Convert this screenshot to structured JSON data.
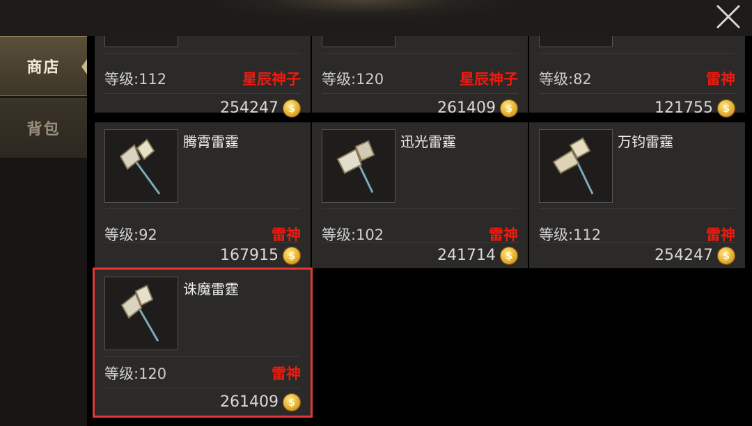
{
  "window": {
    "close_icon": "close-icon"
  },
  "sidebar": {
    "tabs": [
      {
        "label": "商店",
        "active": true
      },
      {
        "label": "背包",
        "active": false
      }
    ]
  },
  "currency_icon": "gold-coin-icon",
  "coin_glyph": "$",
  "items": [
    {
      "name": "",
      "level": "等级:112",
      "tag": "星辰神子",
      "price": "254247"
    },
    {
      "name": "",
      "level": "等级:120",
      "tag": "星辰神子",
      "price": "261409"
    },
    {
      "name": "",
      "level": "等级:82",
      "tag": "雷神",
      "price": "121755"
    },
    {
      "name": "腾霄雷霆",
      "level": "等级:92",
      "tag": "雷神",
      "price": "167915"
    },
    {
      "name": "迅光雷霆",
      "level": "等级:102",
      "tag": "雷神",
      "price": "241714"
    },
    {
      "name": "万钧雷霆",
      "level": "等级:112",
      "tag": "雷神",
      "price": "254247"
    },
    {
      "name": "诛魔雷霆",
      "level": "等级:120",
      "tag": "雷神",
      "price": "261409",
      "selected": true
    }
  ],
  "colors": {
    "tag_red": "#f01a10",
    "selected_border": "#e23a33",
    "coin_gold": "#e0a72a"
  }
}
